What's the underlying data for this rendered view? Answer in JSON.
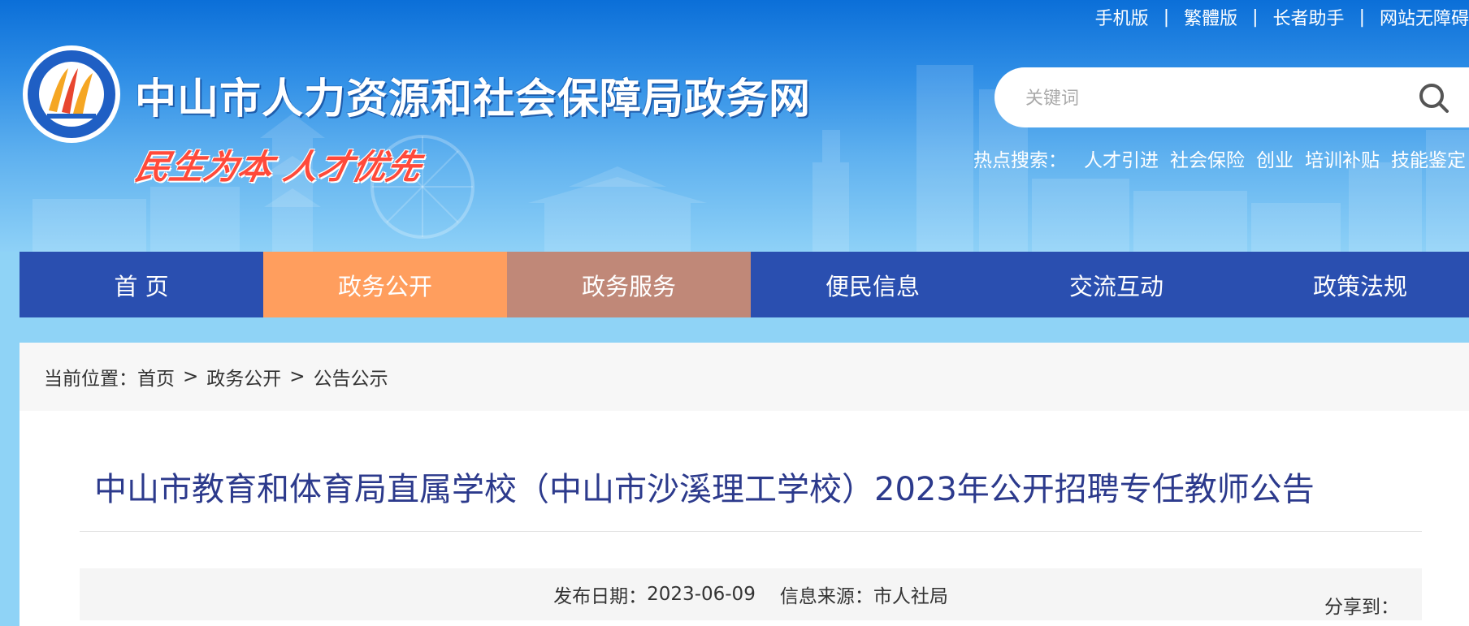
{
  "top_links": [
    "手机版",
    "繁體版",
    "长者助手",
    "网站无障碍"
  ],
  "top_link_separator": "|",
  "site_title": "中山市人力资源和社会保障局政务网",
  "slogan": "民生为本 人才优先",
  "search": {
    "placeholder": "关键词",
    "icon": "search-icon"
  },
  "hot_search": {
    "label": "热点搜索：",
    "items": [
      "人才引进",
      "社会保险",
      "创业",
      "培训补贴",
      "技能鉴定"
    ]
  },
  "nav": {
    "items": [
      "首 页",
      "政务公开",
      "政务服务",
      "便民信息",
      "交流互动",
      "政策法规"
    ],
    "active_index": 1,
    "hover_index": 2
  },
  "breadcrumb": {
    "prefix": "当前位置：",
    "items": [
      "首页",
      "政务公开",
      "公告公示"
    ],
    "separator": ">"
  },
  "article": {
    "title": "中山市教育和体育局直属学校（中山市沙溪理工学校）2023年公开招聘专任教师公告",
    "publish_label": "发布日期：",
    "publish_date": "2023-06-09",
    "source_label": "信息来源：",
    "source": "市人社局",
    "share_label": "分享到："
  },
  "colors": {
    "header_top": "#0b6fd8",
    "header_bottom": "#8ed1f7",
    "nav_bg": "#2a4fb0",
    "nav_active": "#ff9e5e",
    "nav_hover": "#c08878",
    "title_color": "#2c3a8c",
    "slogan_color": "#ff4a3a"
  }
}
